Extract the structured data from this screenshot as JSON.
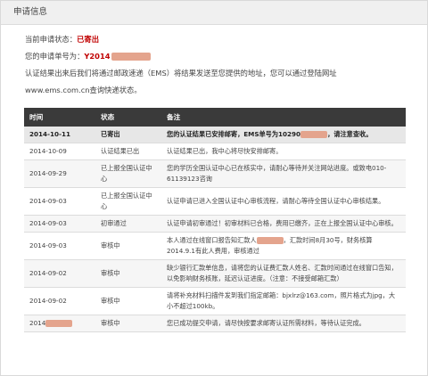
{
  "header": {
    "title": "申请信息"
  },
  "info": {
    "status_label": "当前申请状态：",
    "status_value": "已寄出",
    "order_label": "您的申请单号为：",
    "order_value": "Y2014",
    "notice_line1": "认证结果出来后我们将通过邮政速递（EMS）将结果发送至您提供的地址，您可以通过登陆网址",
    "notice_line2": "www.ems.com.cn查询快递状态。"
  },
  "table": {
    "headers": [
      "时间",
      "状态",
      "备注"
    ],
    "rows": [
      {
        "time": "2014-10-11",
        "status": "已寄出",
        "note_pre": "您的认证结果已安排邮寄，EMS单号为10290",
        "note_post": "，请注意查收。"
      },
      {
        "time": "2014-10-09",
        "status": "认证结果已出",
        "note_pre": "认证结果已出，我中心将尽快安排邮寄。",
        "note_post": ""
      },
      {
        "time": "2014-09-29",
        "status": "已上报全国认证中心",
        "note_pre": "您的学历全国认证中心已在核实中，请耐心等待并关注网站进度。或致电010-61139123咨询",
        "note_post": ""
      },
      {
        "time": "2014-09-03",
        "status": "已上报全国认证中心",
        "note_pre": "认证申请已进入全国认证中心审核流程，请耐心等待全国认证中心审核结果。",
        "note_post": ""
      },
      {
        "time": "2014-09-03",
        "status": "初审通过",
        "note_pre": "认证申请初审通过！初审材料已合格，费用已缴齐，正在上报全国认证中心审核。",
        "note_post": ""
      },
      {
        "time": "2014-09-03",
        "status": "审核中",
        "note_pre": "本人通过在线窗口报告知汇款人",
        "note_post": "，汇款时间8月30号，财务核算2014.9.1有此人费用，审核通过"
      },
      {
        "time": "2014-09-02",
        "status": "审核中",
        "note_pre": "缺少银行汇款单信息，请将您的认证费汇款人姓名、汇款时间通过在线窗口告知，以免影响财务核账，延迟认证进度。（注意：不接受邮箱汇款）",
        "note_post": ""
      },
      {
        "time": "2014-09-02",
        "status": "审核中",
        "note_pre": "请将补充材料扫描件发到我们指定邮箱：bjxlrz@163.com，照片格式为jpg，大小不超过100kb。",
        "note_post": ""
      },
      {
        "time": "2014",
        "status": "审核中",
        "note_pre": "您已成功提交申请，请尽快按要求邮寄认证所需材料，等待认证完成。",
        "note_post": ""
      }
    ]
  },
  "colors": {
    "status_red": "#c00000",
    "header_dark": "#3a3a3a",
    "redaction": "#e4a48d"
  }
}
